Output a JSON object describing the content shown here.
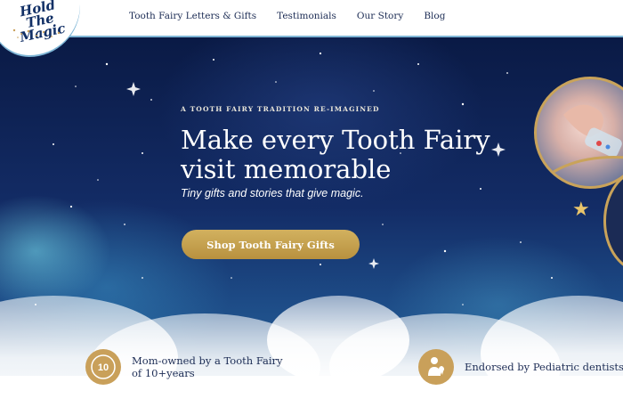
{
  "nav": {
    "items": [
      "Tooth Fairy Letters & Gifts",
      "Testimonials",
      "Our Story",
      "Blog"
    ]
  },
  "logo": {
    "text": "Hold The Magic"
  },
  "hero": {
    "eyebrow": "A TOOTH FAIRY TRADITION RE-IMAGINED",
    "headline": "Make every Tooth Fairy visit memorable",
    "subline": "Tiny gifts and stories that give magic.",
    "cta_label": "Shop Tooth Fairy Gifts"
  },
  "features": [
    {
      "icon": "ten-years-badge-icon",
      "badge_text": "10",
      "text": "Mom-owned by a Tooth Fairy of 10+years"
    },
    {
      "icon": "dentist-icon",
      "text": "Endorsed by Pediatric dentists"
    }
  ],
  "colors": {
    "navy": "#0d1f4a",
    "gold": "#c9a05a",
    "text_dark": "#1d2d55",
    "header_border": "#7fb6d6"
  }
}
